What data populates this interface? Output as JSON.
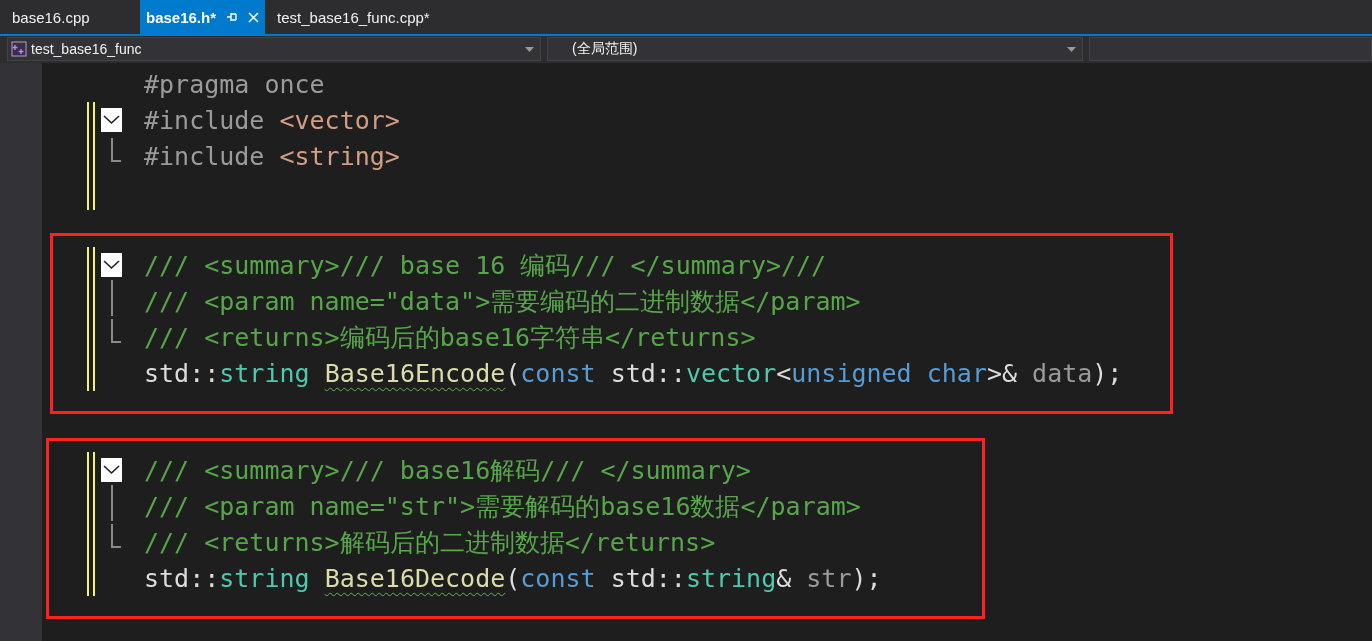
{
  "tabs": [
    {
      "label": "base16.cpp",
      "selected": false,
      "pinnable": false
    },
    {
      "label": "base16.h*",
      "selected": true,
      "pinnable": true
    },
    {
      "label": "test_base16_func.cpp*",
      "selected": false,
      "pinnable": false
    }
  ],
  "navigation": {
    "project": "test_base16_func",
    "scope": "(全局范围)"
  },
  "blocks": [
    {
      "highlighted": false,
      "lines": [
        {
          "changed": false,
          "kind": "none",
          "tokens": [
            {
              "kind": "preprocessor",
              "text": "#pragma once"
            }
          ]
        },
        {
          "changed": true,
          "kind": "open",
          "tokens": [
            {
              "kind": "preprocessor",
              "text": "#include "
            },
            {
              "kind": "string",
              "text": "<vector>"
            }
          ]
        },
        {
          "changed": true,
          "kind": "end",
          "tokens": [
            {
              "kind": "preprocessor",
              "text": "#include "
            },
            {
              "kind": "string",
              "text": "<string>"
            }
          ]
        },
        {
          "changed": true,
          "kind": "none"
        }
      ]
    },
    {
      "highlighted": true,
      "lines": [
        {
          "changed": true,
          "kind": "open",
          "tokens": [
            {
              "kind": "comment",
              "text": "/// <summary>/// base 16 编码/// </summary>///"
            }
          ]
        },
        {
          "changed": true,
          "kind": "continue",
          "tokens": [
            {
              "kind": "comment",
              "text": "/// <param name=\"data\">需要编码的二进制数据</param>"
            }
          ]
        },
        {
          "changed": true,
          "kind": "end",
          "tokens": [
            {
              "kind": "comment",
              "text": "/// <returns>编码后的base16字符串</returns>"
            }
          ]
        },
        {
          "changed": true,
          "kind": "none",
          "tokens": [
            {
              "kind": "plain",
              "text": "std::"
            },
            {
              "kind": "type",
              "text": "string "
            },
            {
              "kind": "function",
              "text": "Base16Encode",
              "squiggle": true
            },
            {
              "kind": "plain",
              "text": "("
            },
            {
              "kind": "keyword",
              "text": "const"
            },
            {
              "kind": "plain",
              "text": " std::"
            },
            {
              "kind": "type",
              "text": "vector"
            },
            {
              "kind": "plain",
              "text": "<"
            },
            {
              "kind": "keyword",
              "text": "unsigned char"
            },
            {
              "kind": "plain",
              "text": ">& "
            },
            {
              "kind": "parameter",
              "text": "data"
            },
            {
              "kind": "plain",
              "text": ");"
            }
          ]
        }
      ]
    },
    {
      "highlighted": true,
      "lines": [
        {
          "changed": true,
          "kind": "open",
          "tokens": [
            {
              "kind": "comment",
              "text": "/// <summary>/// base16解码/// </summary>"
            }
          ]
        },
        {
          "changed": true,
          "kind": "continue",
          "tokens": [
            {
              "kind": "comment",
              "text": "/// <param name=\"str\">需要解码的base16数据</param>"
            }
          ]
        },
        {
          "changed": true,
          "kind": "end",
          "tokens": [
            {
              "kind": "comment",
              "text": "/// <returns>解码后的二进制数据</returns>"
            }
          ]
        },
        {
          "changed": true,
          "kind": "none",
          "tokens": [
            {
              "kind": "plain",
              "text": "std::"
            },
            {
              "kind": "type",
              "text": "string "
            },
            {
              "kind": "function",
              "text": "Base16Decode",
              "squiggle": true
            },
            {
              "kind": "plain",
              "text": "("
            },
            {
              "kind": "keyword",
              "text": "const"
            },
            {
              "kind": "plain",
              "text": " std::"
            },
            {
              "kind": "type",
              "text": "string"
            },
            {
              "kind": "plain",
              "text": "& "
            },
            {
              "kind": "parameter",
              "text": "str"
            },
            {
              "kind": "plain",
              "text": ");"
            }
          ]
        }
      ]
    }
  ]
}
